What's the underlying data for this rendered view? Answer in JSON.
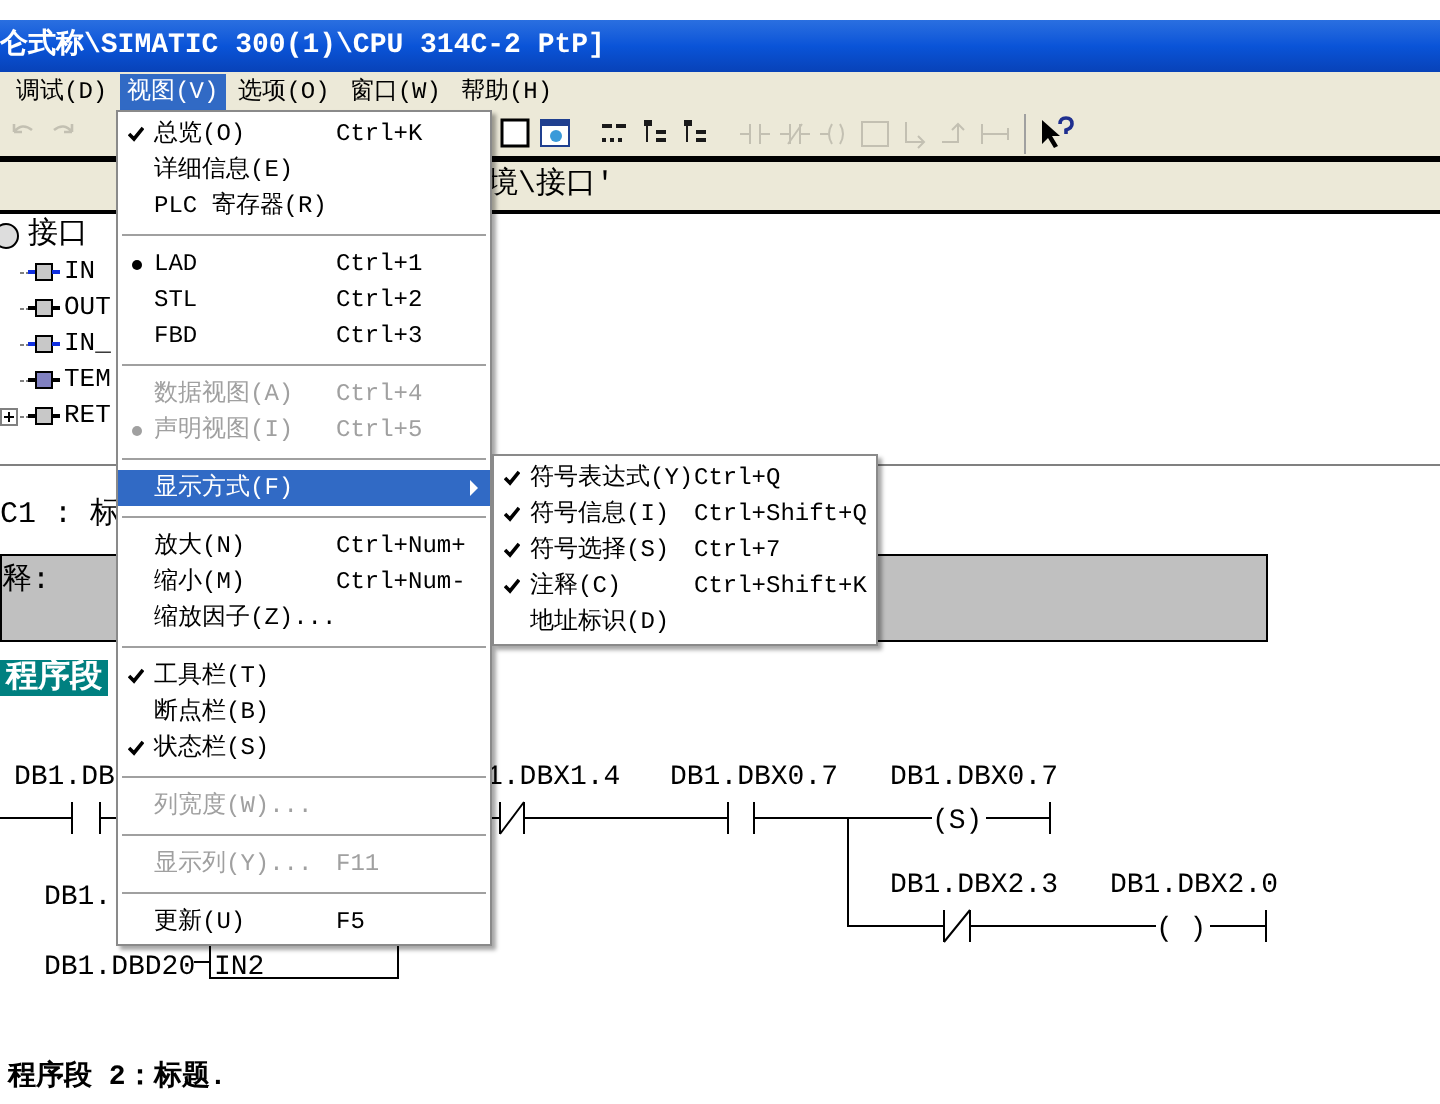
{
  "window": {
    "title": "仑式称\\SIMATIC 300(1)\\CPU 314C-2 PtP]"
  },
  "menubar": [
    {
      "label": "调试(D)",
      "selected": false
    },
    {
      "label": "视图(V)",
      "selected": true
    },
    {
      "label": "选项(O)",
      "selected": false
    },
    {
      "label": "窗口(W)",
      "selected": false
    },
    {
      "label": "帮助(H)",
      "selected": false
    }
  ],
  "toolbar": {
    "buttons": [
      {
        "disabled": true
      },
      {
        "disabled": true
      },
      {
        "disabled": false
      },
      {
        "disabled": false
      },
      {
        "disabled": false
      },
      {
        "disabled": false
      },
      {
        "disabled": false
      },
      {
        "disabled": true
      },
      {
        "disabled": true
      },
      {
        "disabled": true
      },
      {
        "disabled": true
      },
      {
        "disabled": true
      },
      {
        "disabled": true
      },
      {
        "disabled": true
      },
      {
        "disabled": false
      }
    ]
  },
  "path_bar": {
    "text": "境\\接口'"
  },
  "tree": {
    "root": "接口",
    "children": [
      {
        "label": "IN",
        "kind": "input"
      },
      {
        "label": "OUT",
        "kind": "output"
      },
      {
        "label": "IN_",
        "kind": "input"
      },
      {
        "label": "TEM",
        "kind": "temp"
      },
      {
        "label": "RET",
        "kind": "return"
      }
    ]
  },
  "network1": {
    "title": "C1 : 标",
    "comment": "释:",
    "label": "程序段"
  },
  "ladder": {
    "operands": [
      "DB1.DB",
      "1.DBX1.4",
      "DB1.DBX0.7",
      "DB1.DBX0.7",
      "DB1.DBX2.3",
      "DB1.DBX2.0",
      "DB1.",
      "DB1.DBD20"
    ],
    "coils": [
      "(S)",
      "( )"
    ],
    "box_input": "IN2"
  },
  "network2": {
    "title": "程序段 2：标题."
  },
  "menu": {
    "items": [
      {
        "kind": "check",
        "label": "总览(O)",
        "shortcut": "Ctrl+K",
        "checked": true,
        "disabled": false,
        "selected": false
      },
      {
        "kind": "check",
        "label": "详细信息(E)",
        "checked": false,
        "disabled": false,
        "selected": false
      },
      {
        "kind": "check",
        "label": "PLC 寄存器(R)",
        "checked": false,
        "disabled": false,
        "selected": false
      },
      {
        "kind": "separator"
      },
      {
        "kind": "radio",
        "label": "LAD",
        "shortcut": "Ctrl+1",
        "checked": true,
        "disabled": false,
        "selected": false
      },
      {
        "kind": "radio",
        "label": "STL",
        "shortcut": "Ctrl+2",
        "checked": false,
        "disabled": false,
        "selected": false
      },
      {
        "kind": "radio",
        "label": "FBD",
        "shortcut": "Ctrl+3",
        "checked": false,
        "disabled": false,
        "selected": false
      },
      {
        "kind": "separator"
      },
      {
        "kind": "radio",
        "label": "数据视图(A)",
        "shortcut": "Ctrl+4",
        "checked": false,
        "disabled": true,
        "selected": false
      },
      {
        "kind": "radio",
        "label": "声明视图(I)",
        "shortcut": "Ctrl+5",
        "checked": true,
        "disabled": true,
        "selected": false
      },
      {
        "kind": "separator"
      },
      {
        "kind": "submenu",
        "label": "显示方式(F)",
        "disabled": false,
        "selected": true
      },
      {
        "kind": "separator"
      },
      {
        "kind": "check",
        "label": "放大(N)",
        "shortcut": "Ctrl+Num+",
        "checked": false,
        "disabled": false,
        "selected": false
      },
      {
        "kind": "check",
        "label": "缩小(M)",
        "shortcut": "Ctrl+Num-",
        "checked": false,
        "disabled": false,
        "selected": false
      },
      {
        "kind": "check",
        "label": "缩放因子(Z)...",
        "checked": false,
        "disabled": false,
        "selected": false
      },
      {
        "kind": "separator"
      },
      {
        "kind": "check",
        "label": "工具栏(T)",
        "checked": true,
        "disabled": false,
        "selected": false
      },
      {
        "kind": "check",
        "label": "断点栏(B)",
        "checked": false,
        "disabled": false,
        "selected": false
      },
      {
        "kind": "check",
        "label": "状态栏(S)",
        "checked": true,
        "disabled": false,
        "selected": false
      },
      {
        "kind": "separator"
      },
      {
        "kind": "check",
        "label": "列宽度(W)...",
        "checked": false,
        "disabled": true,
        "selected": false
      },
      {
        "kind": "separator"
      },
      {
        "kind": "check",
        "label": "显示列(Y)...",
        "shortcut": "F11",
        "checked": false,
        "disabled": true,
        "selected": false
      },
      {
        "kind": "separator"
      },
      {
        "kind": "check",
        "label": "更新(U)",
        "shortcut": "F5",
        "checked": false,
        "disabled": false,
        "selected": false
      }
    ]
  },
  "submenu": {
    "items": [
      {
        "label": "符号表达式(Y)",
        "shortcut": "Ctrl+Q",
        "checked": true
      },
      {
        "label": "符号信息(I)",
        "shortcut": "Ctrl+Shift+Q",
        "checked": true
      },
      {
        "label": "符号选择(S)",
        "shortcut": "Ctrl+7",
        "checked": true
      },
      {
        "label": "注释(C)",
        "shortcut": "Ctrl+Shift+K",
        "checked": true
      },
      {
        "label": "地址标识(D)",
        "checked": false
      }
    ]
  }
}
